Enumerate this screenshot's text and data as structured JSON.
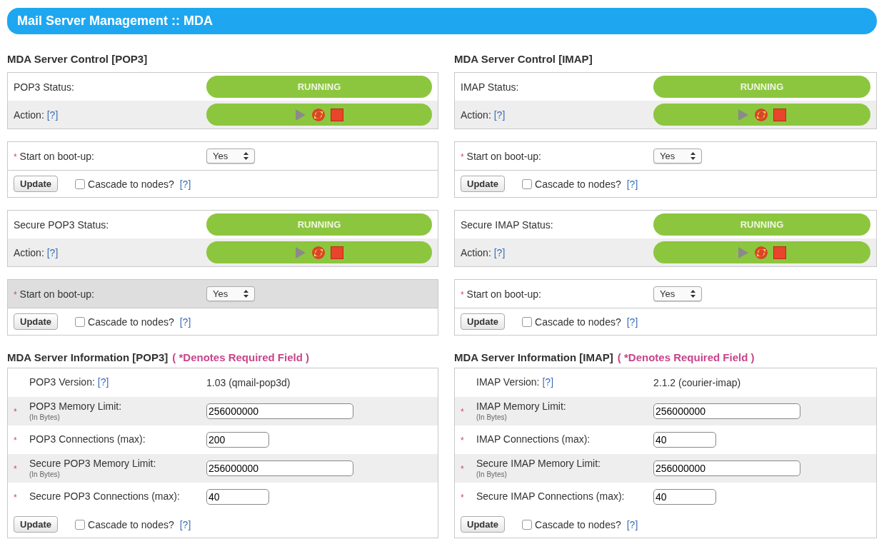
{
  "title": "Mail Server Management :: MDA",
  "columns": [
    {
      "control_heading": "MDA Server Control [POP3]",
      "services": [
        {
          "status_label": "POP3 Status:",
          "status": "RUNNING",
          "running": true,
          "action_label": "Action:",
          "action_help": "[?]",
          "boot_mark": "*",
          "boot_label": "Start on boot-up:",
          "boot_value": "Yes",
          "boot_shaded": false,
          "update": "Update",
          "cascade_label": "Cascade to nodes?",
          "cascade_checked": false,
          "cascade_help": "[?]"
        },
        {
          "status_label": "Secure POP3 Status:",
          "status": "RUNNING",
          "running": true,
          "action_label": "Action:",
          "action_help": "[?]",
          "boot_mark": "*",
          "boot_label": "Start on boot-up:",
          "boot_value": "Yes",
          "boot_shaded": true,
          "update": "Update",
          "cascade_label": "Cascade to nodes?",
          "cascade_checked": false,
          "cascade_help": "[?]"
        }
      ],
      "info_heading": "MDA Server Information [POP3]",
      "required_note": "( *Denotes Required Field )",
      "info_rows": [
        {
          "kind": "text",
          "label": "POP3 Version:",
          "help": "[?]",
          "value": "1.03 (qmail-pop3d)"
        },
        {
          "kind": "wide-field",
          "mark": "*",
          "label": "POP3 Memory Limit:",
          "sublabel": "(In Bytes)",
          "value": "256000000"
        },
        {
          "kind": "narrow-field",
          "mark": "*",
          "label": "POP3 Connections (max):",
          "value": "200"
        },
        {
          "kind": "wide-field",
          "mark": "*",
          "label": "Secure POP3 Memory Limit:",
          "sublabel": "(In Bytes)",
          "value": "256000000"
        },
        {
          "kind": "narrow-field",
          "mark": "*",
          "label": "Secure POP3 Connections (max):",
          "value": "40"
        }
      ],
      "update": "Update",
      "cascade_label": "Cascade to nodes?",
      "cascade_checked": false,
      "cascade_help": "[?]"
    },
    {
      "control_heading": "MDA Server Control [IMAP]",
      "services": [
        {
          "status_label": "IMAP Status:",
          "status": "RUNNING",
          "running": true,
          "action_label": "Action:",
          "action_help": "[?]",
          "boot_mark": "*",
          "boot_label": "Start on boot-up:",
          "boot_value": "Yes",
          "boot_shaded": false,
          "update": "Update",
          "cascade_label": "Cascade to nodes?",
          "cascade_checked": false,
          "cascade_help": "[?]"
        },
        {
          "status_label": "Secure IMAP Status:",
          "status": "RUNNING",
          "running": true,
          "action_label": "Action:",
          "action_help": "[?]",
          "boot_mark": "*",
          "boot_label": "Start on boot-up:",
          "boot_value": "Yes",
          "boot_shaded": false,
          "update": "Update",
          "cascade_label": "Cascade to nodes?",
          "cascade_checked": false,
          "cascade_help": "[?]"
        }
      ],
      "info_heading": "MDA Server Information [IMAP]",
      "required_note": "( *Denotes Required Field )",
      "info_rows": [
        {
          "kind": "text",
          "label": "IMAP Version:",
          "help": "[?]",
          "value": "2.1.2 (courier-imap)"
        },
        {
          "kind": "wide-field",
          "mark": "*",
          "label": "IMAP Memory Limit:",
          "sublabel": "(In Bytes)",
          "value": "256000000"
        },
        {
          "kind": "narrow-field",
          "mark": "*",
          "label": "IMAP Connections (max):",
          "value": "40"
        },
        {
          "kind": "wide-field",
          "mark": "*",
          "label": "Secure IMAP Memory Limit:",
          "sublabel": "(In Bytes)",
          "value": "256000000"
        },
        {
          "kind": "narrow-field",
          "mark": "*",
          "label": "Secure IMAP Connections (max):",
          "value": "40"
        }
      ],
      "update": "Update",
      "cascade_label": "Cascade to nodes?",
      "cascade_checked": false,
      "cascade_help": "[?]"
    }
  ]
}
